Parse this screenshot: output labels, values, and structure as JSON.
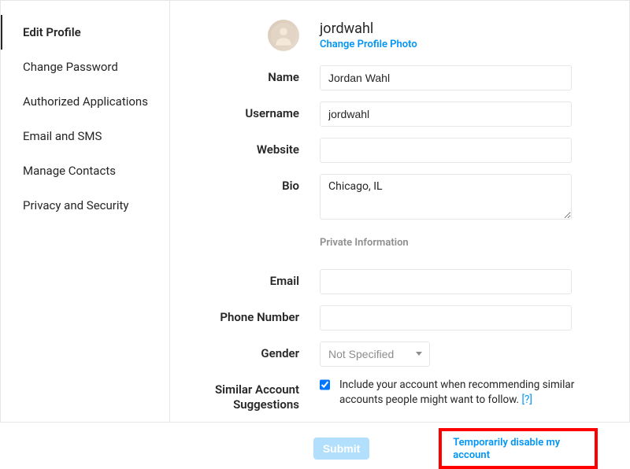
{
  "sidebar": {
    "items": [
      {
        "label": "Edit Profile"
      },
      {
        "label": "Change Password"
      },
      {
        "label": "Authorized Applications"
      },
      {
        "label": "Email and SMS"
      },
      {
        "label": "Manage Contacts"
      },
      {
        "label": "Privacy and Security"
      }
    ]
  },
  "header": {
    "username": "jordwahl",
    "change_photo": "Change Profile Photo"
  },
  "form": {
    "name_label": "Name",
    "name_value": "Jordan Wahl",
    "username_label": "Username",
    "username_value": "jordwahl",
    "website_label": "Website",
    "website_value": "",
    "bio_label": "Bio",
    "bio_value": "Chicago, IL",
    "private_heading": "Private Information",
    "email_label": "Email",
    "email_value": "",
    "phone_label": "Phone Number",
    "phone_value": "",
    "gender_label": "Gender",
    "gender_value": "Not Specified",
    "similar_label": "Similar Account Suggestions",
    "similar_text": "Include your account when recommending similar accounts people might want to follow.",
    "similar_help": "[?]"
  },
  "footer": {
    "submit": "Submit",
    "disable": "Temporarily disable my account"
  }
}
